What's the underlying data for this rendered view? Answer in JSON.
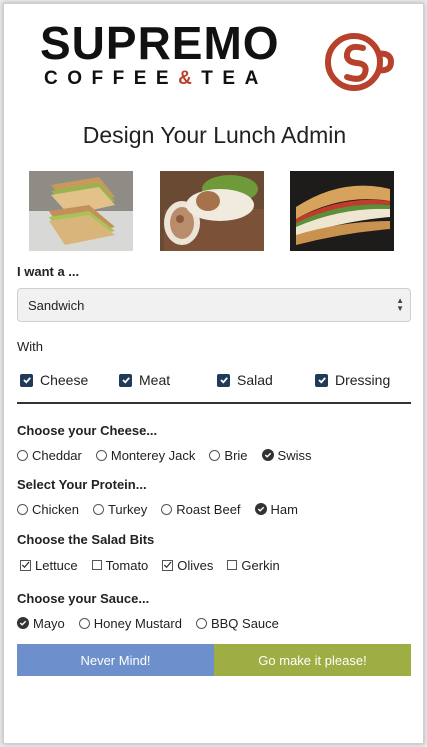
{
  "brand": {
    "name": "SUPREMO",
    "tagline_before": "COFFEE",
    "tagline_amp": "&",
    "tagline_after": "TEA",
    "accent_color": "#b8412c"
  },
  "page_title": "Design Your Lunch Admin",
  "photos": [
    {
      "name": "sandwich-photo"
    },
    {
      "name": "wrap-photo"
    },
    {
      "name": "panini-photo"
    }
  ],
  "form": {
    "want_label": "I want a ...",
    "want_value": "Sandwich",
    "with_label": "With",
    "with_options": [
      {
        "label": "Cheese",
        "checked": true
      },
      {
        "label": "Meat",
        "checked": true
      },
      {
        "label": "Salad",
        "checked": true
      },
      {
        "label": "Dressing",
        "checked": true
      }
    ],
    "cheese": {
      "heading": "Choose your Cheese...",
      "options": [
        "Cheddar",
        "Monterey Jack",
        "Brie",
        "Swiss"
      ],
      "selected": "Swiss"
    },
    "protein": {
      "heading": "Select Your Protein...",
      "options": [
        "Chicken",
        "Turkey",
        "Roast Beef",
        "Ham"
      ],
      "selected": "Ham"
    },
    "salad": {
      "heading": "Choose the Salad Bits",
      "options": [
        {
          "label": "Lettuce",
          "checked": true
        },
        {
          "label": "Tomato",
          "checked": false
        },
        {
          "label": "Olives",
          "checked": true
        },
        {
          "label": "Gerkin",
          "checked": false
        }
      ]
    },
    "sauce": {
      "heading": "Choose your Sauce...",
      "options": [
        "Mayo",
        "Honey Mustard",
        "BBQ Sauce"
      ],
      "selected": "Mayo"
    }
  },
  "buttons": {
    "cancel": "Never Mind!",
    "submit": "Go make it please!",
    "cancel_color": "#6d8fcb",
    "submit_color": "#9eae45"
  }
}
